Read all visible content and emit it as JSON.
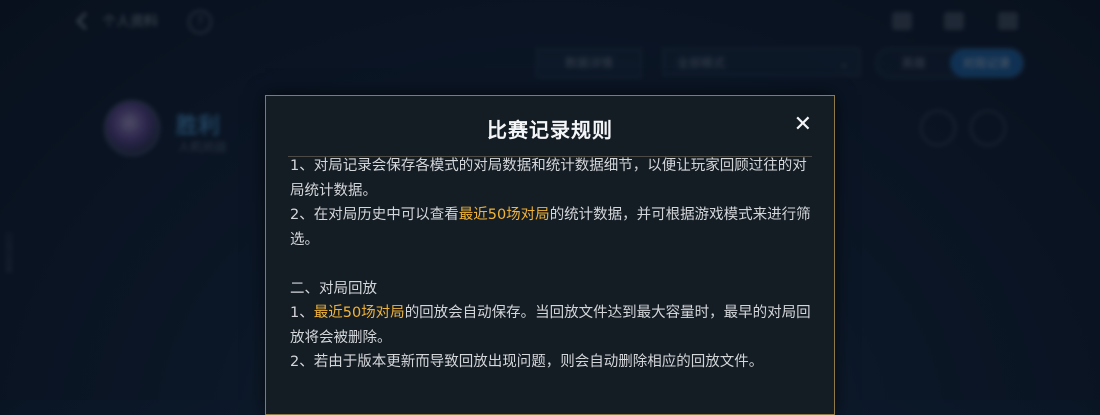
{
  "header": {
    "title": "个人资料",
    "help": "?"
  },
  "toolbar": {
    "detail_label": "数据详情",
    "filter_value": "全部模式",
    "toggle": [
      "英雄",
      "对局记录"
    ]
  },
  "profile": {
    "name": "胜利",
    "subtitle": "人机对战"
  },
  "side_mark": "21952008",
  "modal": {
    "title": "比赛记录规则",
    "close": "✕",
    "p1": "1、对局记录会保存各模式的对局数据和统计数据细节，以便让玩家回顾过往的对局统计数据。",
    "p2_a": "2、在对局历史中可以查看",
    "p2_hl": "最近50场对局",
    "p2_b": "的统计数据，并可根据游戏模式来进行筛选。",
    "section2_title": "二、对局回放",
    "p3_a": "1、",
    "p3_hl": "最近50场对局",
    "p3_b": "的回放会自动保存。当回放文件达到最大容量时，最早的对局回放将会被删除。",
    "p4": "2、若由于版本更新而导致回放出现问题，则会自动删除相应的回放文件。"
  },
  "colors": {
    "highlight": "#f0b43a",
    "border": "#8f7a4a",
    "accent": "#1f6fb8"
  }
}
